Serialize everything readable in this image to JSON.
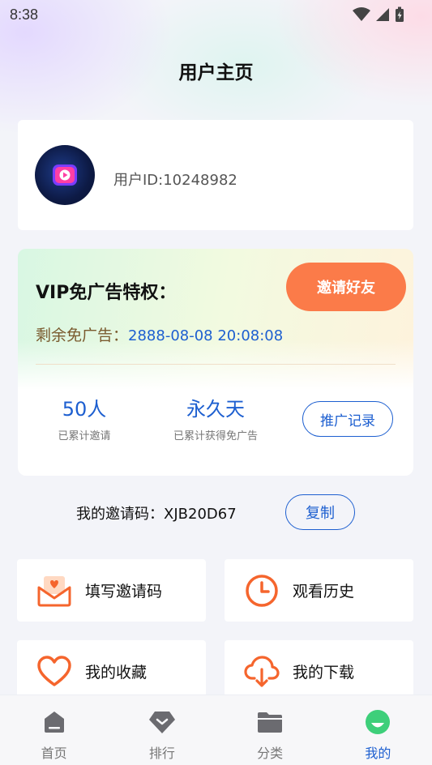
{
  "status_bar": {
    "time": "8:38"
  },
  "header": {
    "title": "用户主页"
  },
  "profile": {
    "user_id": "用户ID:10248982"
  },
  "vip": {
    "title": "VIP免广告特权：",
    "invite_button": "邀请好友",
    "remaining_label": "剩余免广告：",
    "remaining_date": "2888-08-08 20:08:08",
    "stats": [
      {
        "value": "50人",
        "label": "已累计邀请"
      },
      {
        "value": "永久天",
        "label": "已累计获得免广告"
      }
    ],
    "promo_button": "推广记录"
  },
  "invite_code": {
    "text": "我的邀请码：XJB20D67",
    "copy_button": "复制"
  },
  "tiles": [
    {
      "label": "填写邀请码",
      "icon": "envelope-heart-icon"
    },
    {
      "label": "观看历史",
      "icon": "clock-icon"
    },
    {
      "label": "我的收藏",
      "icon": "heart-icon"
    },
    {
      "label": "我的下载",
      "icon": "cloud-download-icon"
    }
  ],
  "tab_bar": {
    "items": [
      {
        "label": "首页",
        "icon": "home-icon"
      },
      {
        "label": "排行",
        "icon": "ranking-icon"
      },
      {
        "label": "分类",
        "icon": "folder-icon"
      },
      {
        "label": "我的",
        "icon": "profile-icon"
      }
    ],
    "active": "我的"
  },
  "colors": {
    "accent": "#1d5fd0",
    "invite_button": "#fb7b49",
    "icon_orange": "#f5652d",
    "tab_active_icon": "#3ecf7a"
  }
}
